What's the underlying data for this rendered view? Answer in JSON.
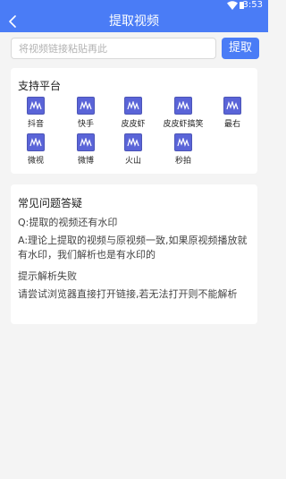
{
  "status_bar": {
    "time": "3:53"
  },
  "header": {
    "title": "提取视频"
  },
  "search": {
    "placeholder": "将视频链接粘贴再此",
    "value": "",
    "button_label": "提取"
  },
  "platforms": {
    "title": "支持平台",
    "items": [
      {
        "label": "抖音"
      },
      {
        "label": "快手"
      },
      {
        "label": "皮皮虾"
      },
      {
        "label": "皮皮虾搞笑"
      },
      {
        "label": "最右"
      },
      {
        "label": "微视"
      },
      {
        "label": "微博"
      },
      {
        "label": "火山"
      },
      {
        "label": "秒拍"
      }
    ]
  },
  "faq": {
    "title": "常见问题答疑",
    "q1": "Q:提取的视频还有水印",
    "a1": "A:理论上提取的视频与原视频一致,如果原视频播放就有水印，我们解析也是有水印的",
    "q2": "提示解析失败",
    "a2": "请尝试浏览器直接打开链接,若无法打开则不能解析"
  },
  "colors": {
    "accent": "#4a7cf6",
    "logo": "#5a64d8"
  }
}
